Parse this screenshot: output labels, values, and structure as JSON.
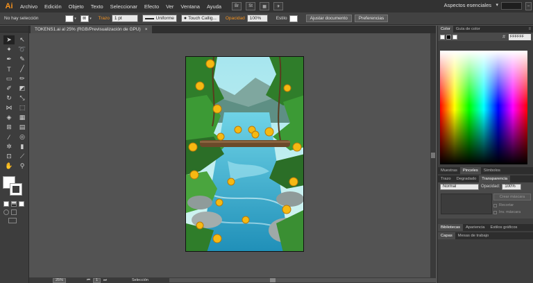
{
  "app": {
    "logo": "Ai",
    "workspace": "Aspectos esenciales"
  },
  "menu": [
    "Archivo",
    "Edición",
    "Objeto",
    "Texto",
    "Seleccionar",
    "Efecto",
    "Ver",
    "Ventana",
    "Ayuda"
  ],
  "menubar_icons": {
    "br": "Br",
    "st": "St"
  },
  "control": {
    "selection_status": "No hay selección",
    "stroke_label": "Trazo",
    "stroke_weight": "1 pt",
    "stroke_profile": "Uniforme",
    "brush": "Touch Callig...",
    "opacity_label": "Opacidad",
    "opacity_value": "100%",
    "style_label": "Estilo",
    "fit_document": "Ajustar documento",
    "preferences": "Preferencias"
  },
  "document": {
    "tab_title": "TOKENS1.ai al 25% (RGB/Previsualización de GPU)",
    "close": "×"
  },
  "status": {
    "zoom": "25%",
    "page": "1",
    "tool": "Selección"
  },
  "panels": {
    "color_tabs": [
      "Color",
      "Guía de color"
    ],
    "hex_value": "FFFFFF",
    "swatch_tabs": [
      "Muestras",
      "Pinceles",
      "Símbolos"
    ],
    "stroke_tabs": [
      "Trazo",
      "Degradado",
      "Transparencia"
    ],
    "blend_mode": "Normal",
    "opacity_label": "Opacidad:",
    "opacity_value": "100%",
    "make_mask": "Crear máscara",
    "clip": "Recortar",
    "invert_mask": "Inv. máscara",
    "library_tabs": [
      "Bibliotecas",
      "Apariencia",
      "Estilos gráficos"
    ],
    "layer_tabs": [
      "Capas",
      "Mesas de trabajo"
    ]
  },
  "colors": {
    "accent": "#f7931e",
    "panel": "#3e3e3e",
    "canvas": "#535353"
  }
}
